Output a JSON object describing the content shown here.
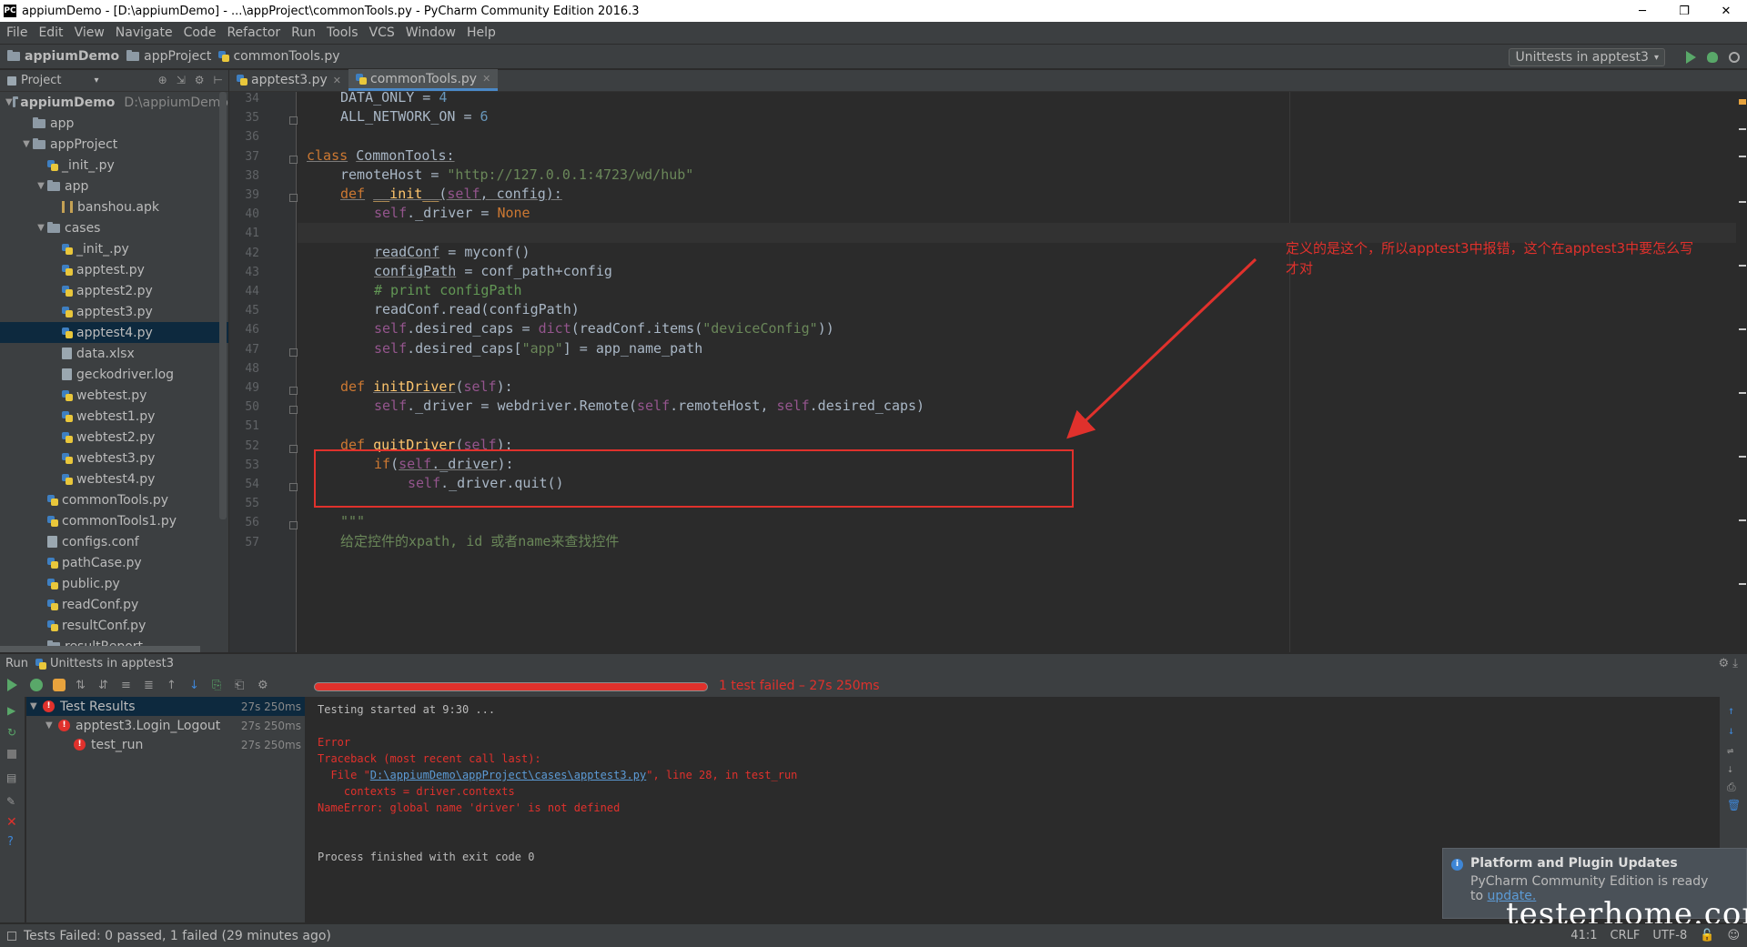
{
  "window": {
    "title": "appiumDemo - [D:\\appiumDemo] - ...\\appProject\\commonTools.py - PyCharm Community Edition 2016.3",
    "app_icon": "PC",
    "buttons": [
      "─",
      "❐",
      "✕"
    ]
  },
  "menu": [
    "File",
    "Edit",
    "View",
    "Navigate",
    "Code",
    "Refactor",
    "Run",
    "Tools",
    "VCS",
    "Window",
    "Help"
  ],
  "breadcrumb": [
    "appiumDemo",
    "appProject",
    "commonTools.py"
  ],
  "run_config": "Unittests in apptest3",
  "project_panel": {
    "label": "Project"
  },
  "tabs": [
    {
      "label": "apptest3.py",
      "active": false
    },
    {
      "label": "commonTools.py",
      "active": true
    }
  ],
  "tree": [
    {
      "depth": 0,
      "arrow": "▼",
      "icon": "folder",
      "label": "appiumDemo",
      "path": "D:\\appiumDemo",
      "bold": true
    },
    {
      "depth": 1,
      "arrow": "",
      "icon": "folder",
      "label": "app"
    },
    {
      "depth": 1,
      "arrow": "▼",
      "icon": "folder",
      "label": "appProject"
    },
    {
      "depth": 2,
      "arrow": "",
      "icon": "py",
      "label": "_init_.py"
    },
    {
      "depth": 2,
      "arrow": "▼",
      "icon": "folder",
      "label": "app"
    },
    {
      "depth": 3,
      "arrow": "",
      "icon": "apk",
      "label": "banshou.apk"
    },
    {
      "depth": 2,
      "arrow": "▼",
      "icon": "folder",
      "label": "cases"
    },
    {
      "depth": 3,
      "arrow": "",
      "icon": "py",
      "label": "_init_.py"
    },
    {
      "depth": 3,
      "arrow": "",
      "icon": "py",
      "label": "apptest.py"
    },
    {
      "depth": 3,
      "arrow": "",
      "icon": "py",
      "label": "apptest2.py"
    },
    {
      "depth": 3,
      "arrow": "",
      "icon": "py",
      "label": "apptest3.py"
    },
    {
      "depth": 3,
      "arrow": "",
      "icon": "py",
      "label": "apptest4.py",
      "selected": true
    },
    {
      "depth": 3,
      "arrow": "",
      "icon": "file",
      "label": "data.xlsx"
    },
    {
      "depth": 3,
      "arrow": "",
      "icon": "file",
      "label": "geckodriver.log"
    },
    {
      "depth": 3,
      "arrow": "",
      "icon": "py",
      "label": "webtest.py"
    },
    {
      "depth": 3,
      "arrow": "",
      "icon": "py",
      "label": "webtest1.py"
    },
    {
      "depth": 3,
      "arrow": "",
      "icon": "py",
      "label": "webtest2.py"
    },
    {
      "depth": 3,
      "arrow": "",
      "icon": "py",
      "label": "webtest3.py"
    },
    {
      "depth": 3,
      "arrow": "",
      "icon": "py",
      "label": "webtest4.py"
    },
    {
      "depth": 2,
      "arrow": "",
      "icon": "py",
      "label": "commonTools.py"
    },
    {
      "depth": 2,
      "arrow": "",
      "icon": "py",
      "label": "commonTools1.py"
    },
    {
      "depth": 2,
      "arrow": "",
      "icon": "file",
      "label": "configs.conf"
    },
    {
      "depth": 2,
      "arrow": "",
      "icon": "py",
      "label": "pathCase.py"
    },
    {
      "depth": 2,
      "arrow": "",
      "icon": "py",
      "label": "public.py"
    },
    {
      "depth": 2,
      "arrow": "",
      "icon": "py",
      "label": "readConf.py"
    },
    {
      "depth": 2,
      "arrow": "",
      "icon": "py",
      "label": "resultConf.py"
    },
    {
      "depth": 2,
      "arrow": "",
      "icon": "folder",
      "label": "resultReport"
    }
  ],
  "code": [
    {
      "n": "34",
      "ind": 1,
      "parts": [
        [
          "DATA_ONLY = ",
          ""
        ],
        [
          "4",
          "num"
        ]
      ]
    },
    {
      "n": "35",
      "ind": 1,
      "parts": [
        [
          "ALL_NETWORK_ON = ",
          ""
        ],
        [
          "6",
          "num"
        ]
      ]
    },
    {
      "n": "36",
      "ind": 0,
      "parts": []
    },
    {
      "n": "37",
      "ind": 0,
      "parts": [
        [
          "class",
          "kw ul"
        ],
        [
          " ",
          ""
        ],
        [
          "CommonTools",
          "ul"
        ],
        [
          ":",
          "ul"
        ]
      ]
    },
    {
      "n": "38",
      "ind": 1,
      "parts": [
        [
          "remoteHost = ",
          ""
        ],
        [
          "\"http://127.0.0.1:4723/wd/hub\"",
          "str"
        ]
      ]
    },
    {
      "n": "39",
      "ind": 1,
      "parts": [
        [
          "def",
          "kw ul"
        ],
        [
          " ",
          ""
        ],
        [
          "__init__",
          "fn ul"
        ],
        [
          "(",
          "ul"
        ],
        [
          "self",
          "self ul"
        ],
        [
          ", config):",
          "ul"
        ]
      ]
    },
    {
      "n": "40",
      "ind": 2,
      "parts": [
        [
          "self",
          "self"
        ],
        [
          "._driver = ",
          ""
        ],
        [
          "None",
          "kw"
        ]
      ]
    },
    {
      "n": "41",
      "ind": 0,
      "parts": [],
      "current": true
    },
    {
      "n": "42",
      "ind": 2,
      "parts": [
        [
          "readConf",
          "ul"
        ],
        [
          " = myconf()",
          ""
        ]
      ]
    },
    {
      "n": "43",
      "ind": 2,
      "parts": [
        [
          "configPath",
          "ul"
        ],
        [
          " = conf_path+config",
          ""
        ]
      ]
    },
    {
      "n": "44",
      "ind": 2,
      "parts": [
        [
          "# print configPath",
          "cmt"
        ]
      ]
    },
    {
      "n": "45",
      "ind": 2,
      "parts": [
        [
          "readConf.read(configPath)",
          ""
        ]
      ]
    },
    {
      "n": "46",
      "ind": 2,
      "parts": [
        [
          "self",
          "self"
        ],
        [
          ".desired_caps = ",
          ""
        ],
        [
          "dict",
          "self"
        ],
        [
          "(readConf.items(",
          ""
        ],
        [
          "\"deviceConfig\"",
          "str"
        ],
        [
          "))",
          ""
        ]
      ]
    },
    {
      "n": "47",
      "ind": 2,
      "parts": [
        [
          "self",
          "self"
        ],
        [
          ".desired_caps[",
          ""
        ],
        [
          "\"app\"",
          "str"
        ],
        [
          "] = app_name_path",
          ""
        ]
      ]
    },
    {
      "n": "48",
      "ind": 0,
      "parts": []
    },
    {
      "n": "49",
      "ind": 1,
      "parts": [
        [
          "def",
          "kw"
        ],
        [
          " ",
          ""
        ],
        [
          "initDriver",
          "fn ul"
        ],
        [
          "(",
          ""
        ],
        [
          "self",
          "self"
        ],
        [
          "):",
          ""
        ]
      ]
    },
    {
      "n": "50",
      "ind": 2,
      "parts": [
        [
          "self",
          "self"
        ],
        [
          "._driver = webdriver.Remote(",
          ""
        ],
        [
          "self",
          "self"
        ],
        [
          ".remoteHost, ",
          ""
        ],
        [
          "self",
          "self"
        ],
        [
          ".desired_caps)",
          ""
        ]
      ]
    },
    {
      "n": "51",
      "ind": 0,
      "parts": []
    },
    {
      "n": "52",
      "ind": 1,
      "parts": [
        [
          "def",
          "kw"
        ],
        [
          " ",
          ""
        ],
        [
          "quitDriver",
          "fn ul"
        ],
        [
          "(",
          ""
        ],
        [
          "self",
          "self"
        ],
        [
          "):",
          ""
        ]
      ]
    },
    {
      "n": "53",
      "ind": 2,
      "parts": [
        [
          "if",
          "kw"
        ],
        [
          "(",
          ""
        ],
        [
          "self",
          "self ul"
        ],
        [
          "._driver",
          "ul"
        ],
        [
          "):",
          ""
        ]
      ]
    },
    {
      "n": "54",
      "ind": 3,
      "parts": [
        [
          "self",
          "self"
        ],
        [
          "._driver.quit()",
          ""
        ]
      ]
    },
    {
      "n": "55",
      "ind": 0,
      "parts": []
    },
    {
      "n": "56",
      "ind": 1,
      "parts": [
        [
          "\"\"\"",
          "str"
        ]
      ]
    },
    {
      "n": "57",
      "ind": 1,
      "parts": [
        [
          "给定控件的xpath, id 或者name来查找控件",
          "str"
        ]
      ]
    }
  ],
  "annotation": {
    "line1": "定义的是这个，所以apptest3中报错，这个在apptest3中要怎么写",
    "line2": "才对"
  },
  "run": {
    "header": "Run",
    "config_label": "Unittests in apptest3",
    "status_text": "1 test failed – 27s 250ms",
    "progress_failed_fraction": 1.0,
    "tests": [
      {
        "depth": 0,
        "arrow": "▼",
        "label": "Test Results",
        "time": "27s 250ms",
        "selected": true
      },
      {
        "depth": 1,
        "arrow": "▼",
        "label": "apptest3.Login_Logout",
        "time": "27s 250ms"
      },
      {
        "depth": 2,
        "arrow": "",
        "label": "test_run",
        "time": "27s 250ms"
      }
    ],
    "console": {
      "started": "Testing started at 9:30 ...",
      "error": "Error",
      "traceback": "Traceback (most recent call last):",
      "file_prefix": "  File \"",
      "file_link": "D:\\appiumDemo\\appProject\\cases\\apptest3.py",
      "file_suffix": "\", line 28, in test_run",
      "code_line": "    contexts = driver.contexts",
      "name_error": "NameError: global name 'driver' is not defined",
      "finished": "Process finished with exit code 0"
    }
  },
  "notification": {
    "title": "Platform and Plugin Updates",
    "body": "PyCharm Community Edition is ready",
    "prefix": "to ",
    "link": "update."
  },
  "watermark": "testerhome.com",
  "status": {
    "message": "Tests Failed: 0 passed, 1 failed (29 minutes ago)",
    "position": "41:1",
    "line_sep": "CRLF",
    "encoding": "UTF-8"
  },
  "colors": {
    "accent": "#4a88c7",
    "error": "#e0312c",
    "success": "#59a869",
    "background": "#2b2b2b"
  }
}
